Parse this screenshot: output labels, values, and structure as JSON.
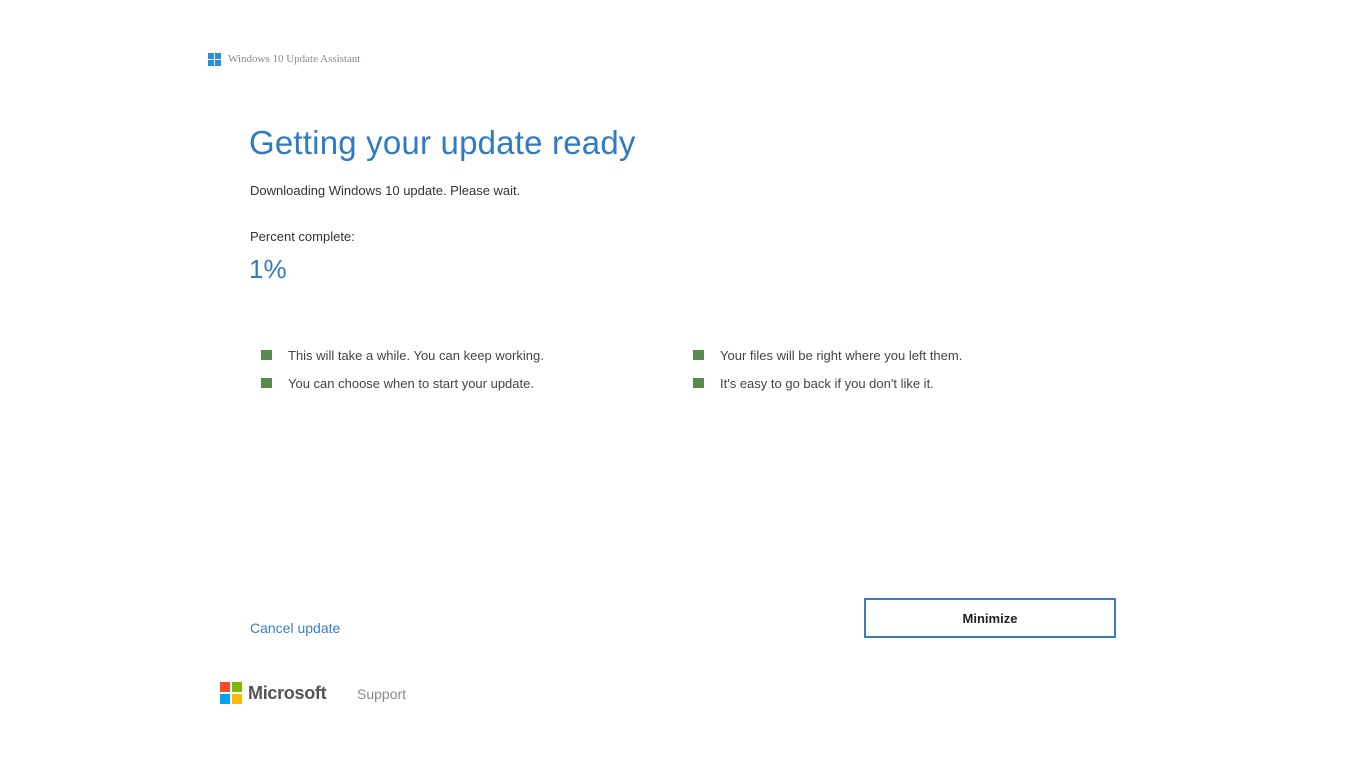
{
  "window": {
    "title": "Windows 10 Update Assistant",
    "icon": "windows-logo-icon"
  },
  "main": {
    "heading": "Getting your update ready",
    "status": "Downloading Windows 10 update. Please wait.",
    "percent_label": "Percent complete:",
    "percent_value": "1%",
    "progress_fraction": 0.01
  },
  "features": {
    "column1": [
      "This will take a while. You can keep working.",
      "You can choose when to start your update."
    ],
    "column2": [
      "Your files will be right where you left them.",
      "It's easy to go back if you don't like it."
    ]
  },
  "actions": {
    "cancel_label": "Cancel update",
    "minimize_label": "Minimize"
  },
  "footer": {
    "brand": "Microsoft",
    "support_label": "Support"
  },
  "colors": {
    "accent": "#2f7bc4",
    "bullet": "#5a8a4e",
    "button_border": "#3d7cc4"
  }
}
